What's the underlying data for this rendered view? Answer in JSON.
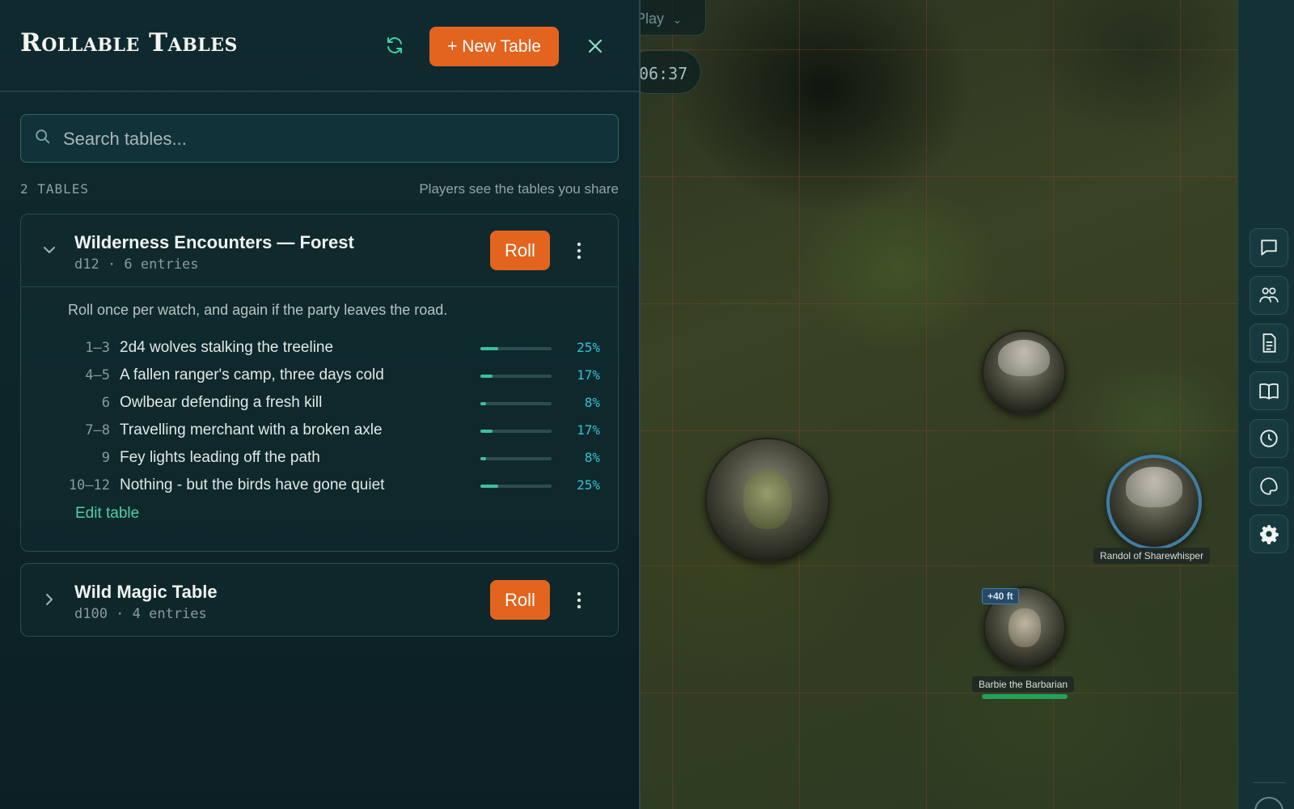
{
  "panel": {
    "title": "Rollable Tables",
    "new_table_label": "+ New Table",
    "search_placeholder": "Search tables...",
    "table_count": "2 TABLES",
    "share_hint": "Players see the tables you share"
  },
  "tables": [
    {
      "name": "Wilderness Encounters — Forest",
      "subtitle": "d12 · 6 entries",
      "roll_label": "Roll",
      "expanded": true,
      "description": "Roll once per watch, and again if the party leaves the road.",
      "entries": [
        {
          "range": "1–3",
          "text": "2d4 wolves stalking the treeline",
          "pct": "25%",
          "fill": 0.25
        },
        {
          "range": "4–5",
          "text": "A fallen ranger's camp, three days cold",
          "pct": "17%",
          "fill": 0.17
        },
        {
          "range": "6",
          "text": "Owlbear defending a fresh kill",
          "pct": "8%",
          "fill": 0.08
        },
        {
          "range": "7–8",
          "text": "Travelling merchant with a broken axle",
          "pct": "17%",
          "fill": 0.17
        },
        {
          "range": "9",
          "text": "Fey lights leading off the path",
          "pct": "8%",
          "fill": 0.08
        },
        {
          "range": "10–12",
          "text": "Nothing - but the birds have gone quiet",
          "pct": "25%",
          "fill": 0.25
        }
      ],
      "edit_label": "Edit table"
    },
    {
      "name": "Wild Magic Table",
      "subtitle": "d100 · 4 entries",
      "roll_label": "Roll",
      "expanded": false
    }
  ],
  "map": {
    "mode_label": "Play",
    "timer": "06:37",
    "tokens": [
      {
        "label": "Randol of Sharewhisper"
      },
      {
        "label": "Barbie the Barbarian",
        "badge": "+40 ft"
      }
    ]
  },
  "rail": {
    "buttons": [
      "chat-icon",
      "party-icon",
      "document-icon",
      "book-icon",
      "clock-icon",
      "palette-icon",
      "gear-icon"
    ]
  },
  "colors": {
    "accent": "#e3641f",
    "link": "#4fd0a8",
    "percent": "#33c2d6",
    "panel_bg": "#0f2a2f"
  }
}
